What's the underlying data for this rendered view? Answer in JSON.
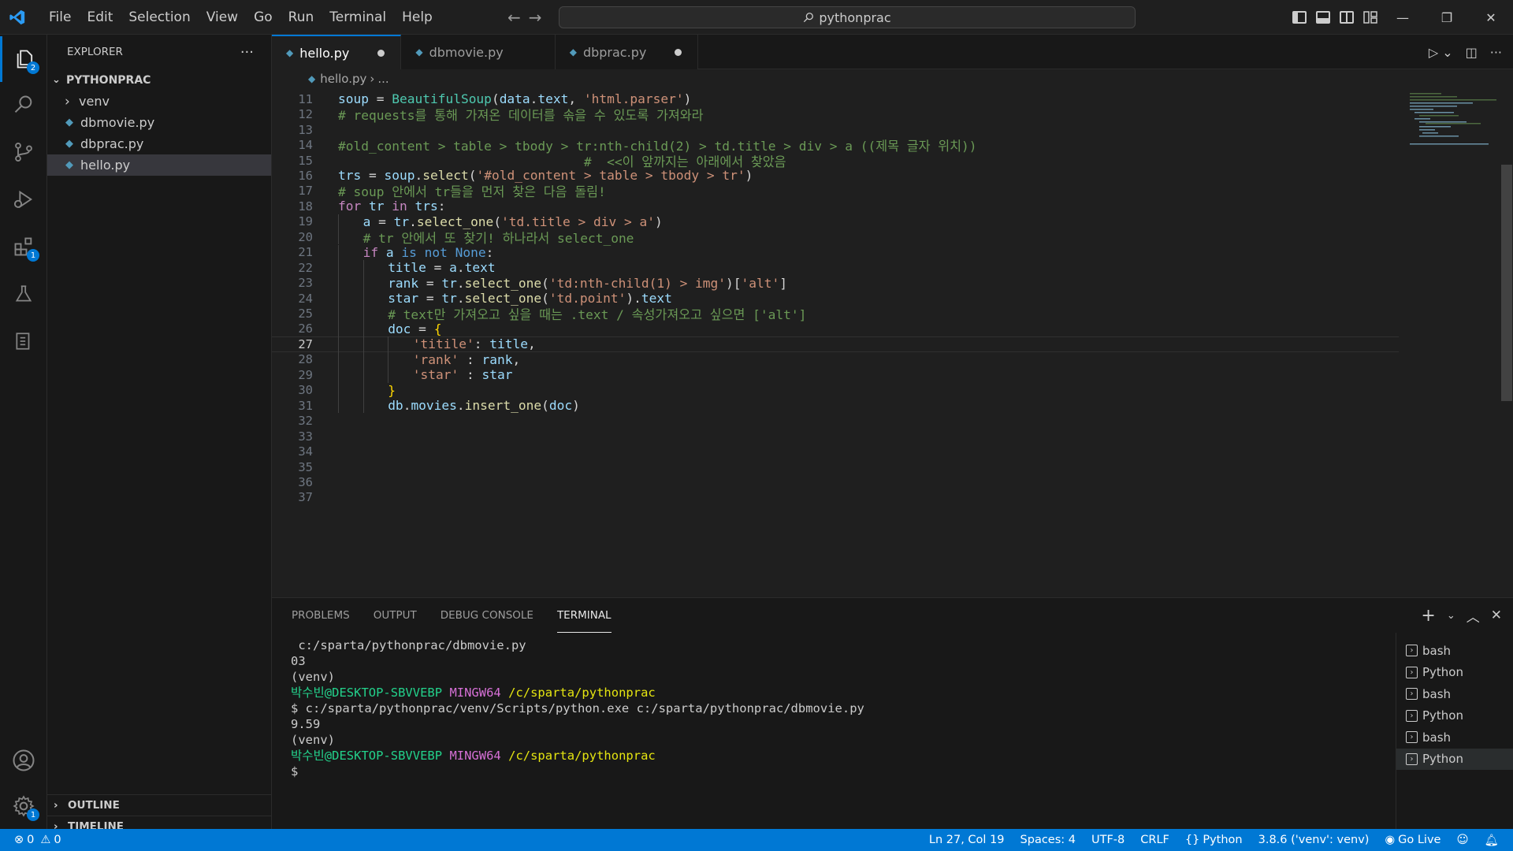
{
  "title_bar": {
    "menu": [
      "File",
      "Edit",
      "Selection",
      "View",
      "Go",
      "Run",
      "Terminal",
      "Help"
    ],
    "search_text": "pythonprac"
  },
  "activity_bar": {
    "explorer_badge": "2",
    "extensions_badge": "1",
    "settings_badge": "1"
  },
  "sidebar": {
    "header": "EXPLORER",
    "more": "···",
    "root": "PYTHONPRAC",
    "items": [
      {
        "label": "venv",
        "type": "folder"
      },
      {
        "label": "dbmovie.py",
        "type": "file"
      },
      {
        "label": "dbprac.py",
        "type": "file"
      },
      {
        "label": "hello.py",
        "type": "file",
        "selected": true
      }
    ],
    "outline": "OUTLINE",
    "timeline": "TIMELINE"
  },
  "tabs": [
    {
      "label": "hello.py",
      "active": true,
      "dirty": true
    },
    {
      "label": "dbmovie.py",
      "active": false,
      "dirty": false
    },
    {
      "label": "dbprac.py",
      "active": false,
      "dirty": true
    }
  ],
  "breadcrumb": {
    "file": "hello.py",
    "sep": "›",
    "rest": "..."
  },
  "code": {
    "current_line": 27,
    "lines": [
      {
        "n": 11,
        "indent": 0,
        "tokens": [
          [
            "var",
            "soup"
          ],
          [
            "op",
            " = "
          ],
          [
            "cls",
            "BeautifulSoup"
          ],
          [
            "op",
            "("
          ],
          [
            "var",
            "data"
          ],
          [
            "op",
            "."
          ],
          [
            "var",
            "text"
          ],
          [
            "op",
            ", "
          ],
          [
            "str",
            "'html.parser'"
          ],
          [
            "op",
            ")"
          ]
        ]
      },
      {
        "n": 12,
        "indent": 0,
        "tokens": [
          [
            "com",
            "# requests를 통해 가져온 데이터를 솎을 수 있도록 가져와라"
          ]
        ]
      },
      {
        "n": 13,
        "indent": 0,
        "tokens": []
      },
      {
        "n": 14,
        "indent": 0,
        "tokens": [
          [
            "com",
            "#old_content > table > tbody > tr:nth-child(2) > td.title > div > a ((제목 글자 위치))"
          ]
        ]
      },
      {
        "n": 15,
        "indent": 0,
        "tokens": [
          [
            "com",
            "                                #  <<이 앞까지는 아래에서 찾았음"
          ]
        ]
      },
      {
        "n": 16,
        "indent": 0,
        "tokens": [
          [
            "var",
            "trs"
          ],
          [
            "op",
            " = "
          ],
          [
            "var",
            "soup"
          ],
          [
            "op",
            "."
          ],
          [
            "fn",
            "select"
          ],
          [
            "op",
            "("
          ],
          [
            "str",
            "'#old_content > table > tbody > tr'"
          ],
          [
            "op",
            ")"
          ]
        ]
      },
      {
        "n": 17,
        "indent": 0,
        "tokens": [
          [
            "com",
            "# soup 안에서 tr들을 먼저 찾은 다음 돌림!"
          ]
        ]
      },
      {
        "n": 18,
        "indent": 0,
        "tokens": [
          [
            "kw",
            "for"
          ],
          [
            "op",
            " "
          ],
          [
            "var",
            "tr"
          ],
          [
            "op",
            " "
          ],
          [
            "kw",
            "in"
          ],
          [
            "op",
            " "
          ],
          [
            "var",
            "trs"
          ],
          [
            "op",
            ":"
          ]
        ]
      },
      {
        "n": 19,
        "indent": 1,
        "tokens": [
          [
            "var",
            "a"
          ],
          [
            "op",
            " = "
          ],
          [
            "var",
            "tr"
          ],
          [
            "op",
            "."
          ],
          [
            "fn",
            "select_one"
          ],
          [
            "op",
            "("
          ],
          [
            "str",
            "'td.title > div > a'"
          ],
          [
            "op",
            ")"
          ]
        ]
      },
      {
        "n": 20,
        "indent": 1,
        "tokens": [
          [
            "com",
            "# tr 안에서 또 찾기! 하나라서 select_one"
          ]
        ]
      },
      {
        "n": 21,
        "indent": 1,
        "tokens": [
          [
            "kw",
            "if"
          ],
          [
            "op",
            " "
          ],
          [
            "var",
            "a"
          ],
          [
            "op",
            " "
          ],
          [
            "const",
            "is not"
          ],
          [
            "op",
            " "
          ],
          [
            "const",
            "None"
          ],
          [
            "op",
            ":"
          ]
        ]
      },
      {
        "n": 22,
        "indent": 2,
        "tokens": [
          [
            "var",
            "title"
          ],
          [
            "op",
            " = "
          ],
          [
            "var",
            "a"
          ],
          [
            "op",
            "."
          ],
          [
            "var",
            "text"
          ]
        ]
      },
      {
        "n": 23,
        "indent": 2,
        "tokens": [
          [
            "var",
            "rank"
          ],
          [
            "op",
            " = "
          ],
          [
            "var",
            "tr"
          ],
          [
            "op",
            "."
          ],
          [
            "fn",
            "select_one"
          ],
          [
            "op",
            "("
          ],
          [
            "str",
            "'td:nth-child(1) > img'"
          ],
          [
            "op",
            ")["
          ],
          [
            "str",
            "'alt'"
          ],
          [
            "op",
            "]"
          ]
        ]
      },
      {
        "n": 24,
        "indent": 2,
        "tokens": [
          [
            "var",
            "star"
          ],
          [
            "op",
            " = "
          ],
          [
            "var",
            "tr"
          ],
          [
            "op",
            "."
          ],
          [
            "fn",
            "select_one"
          ],
          [
            "op",
            "("
          ],
          [
            "str",
            "'td.point'"
          ],
          [
            "op",
            ")."
          ],
          [
            "var",
            "text"
          ]
        ]
      },
      {
        "n": 25,
        "indent": 2,
        "tokens": [
          [
            "com",
            "# text만 가져오고 싶을 때는 .text / 속성가져오고 싶으면 ['alt']"
          ]
        ]
      },
      {
        "n": 26,
        "indent": 2,
        "tokens": [
          [
            "var",
            "doc"
          ],
          [
            "op",
            " = "
          ],
          [
            "br",
            "{"
          ]
        ]
      },
      {
        "n": 27,
        "indent": 3,
        "tokens": [
          [
            "str",
            "'titile'"
          ],
          [
            "op",
            ": "
          ],
          [
            "var",
            "title"
          ],
          [
            "op",
            ","
          ]
        ]
      },
      {
        "n": 28,
        "indent": 3,
        "tokens": [
          [
            "str",
            "'rank'"
          ],
          [
            "op",
            " : "
          ],
          [
            "var",
            "rank"
          ],
          [
            "op",
            ","
          ]
        ]
      },
      {
        "n": 29,
        "indent": 3,
        "tokens": [
          [
            "str",
            "'star'"
          ],
          [
            "op",
            " : "
          ],
          [
            "var",
            "star"
          ]
        ]
      },
      {
        "n": 30,
        "indent": 2,
        "tokens": [
          [
            "br",
            "}"
          ]
        ]
      },
      {
        "n": 31,
        "indent": 2,
        "tokens": [
          [
            "var",
            "db"
          ],
          [
            "op",
            "."
          ],
          [
            "var",
            "movies"
          ],
          [
            "op",
            "."
          ],
          [
            "fn",
            "insert_one"
          ],
          [
            "op",
            "("
          ],
          [
            "var",
            "doc"
          ],
          [
            "op",
            ")"
          ]
        ]
      },
      {
        "n": 32,
        "indent": 0,
        "tokens": []
      },
      {
        "n": 33,
        "indent": 0,
        "tokens": []
      },
      {
        "n": 34,
        "indent": 0,
        "tokens": []
      },
      {
        "n": 35,
        "indent": 0,
        "tokens": []
      },
      {
        "n": 36,
        "indent": 0,
        "tokens": []
      },
      {
        "n": 37,
        "indent": 0,
        "tokens": []
      }
    ]
  },
  "panel": {
    "tabs": [
      "PROBLEMS",
      "OUTPUT",
      "DEBUG CONSOLE",
      "TERMINAL"
    ],
    "active_tab": "TERMINAL",
    "terminal_lines": [
      [
        [
          "",
          " c:/sparta/pythonprac/dbmovie.py"
        ]
      ],
      [
        [
          "",
          "03"
        ]
      ],
      [
        [
          "",
          "(venv)"
        ]
      ],
      [
        [
          "green",
          "박수빈@DESKTOP-SBVVEBP"
        ],
        [
          "",
          " "
        ],
        [
          "magenta",
          "MINGW64"
        ],
        [
          "",
          " "
        ],
        [
          "yellow",
          "/c/sparta/pythonprac"
        ]
      ],
      [
        [
          "",
          "$ c:/sparta/pythonprac/venv/Scripts/python.exe c:/sparta/pythonprac/dbmovie.py"
        ]
      ],
      [
        [
          "",
          "9.59"
        ]
      ],
      [
        [
          "",
          "(venv)"
        ]
      ],
      [
        [
          "green",
          "박수빈@DESKTOP-SBVVEBP"
        ],
        [
          "",
          " "
        ],
        [
          "magenta",
          "MINGW64"
        ],
        [
          "",
          " "
        ],
        [
          "yellow",
          "/c/sparta/pythonprac"
        ]
      ],
      [
        [
          "",
          "$"
        ]
      ]
    ],
    "terminals": [
      {
        "label": "bash"
      },
      {
        "label": "Python"
      },
      {
        "label": "bash"
      },
      {
        "label": "Python"
      },
      {
        "label": "bash"
      },
      {
        "label": "Python",
        "selected": true
      }
    ]
  },
  "status_bar": {
    "errors": "0",
    "warnings": "0",
    "position": "Ln 27, Col 19",
    "spaces": "Spaces: 4",
    "encoding": "UTF-8",
    "eol": "CRLF",
    "language": "Python",
    "interpreter": "3.8.6 ('venv': venv)",
    "go_live": "Go Live"
  },
  "colors": {
    "accent": "#0078d4",
    "status_bar": "#0078d4",
    "editor_bg": "#1f1f1f",
    "sidebar_bg": "#181818"
  }
}
